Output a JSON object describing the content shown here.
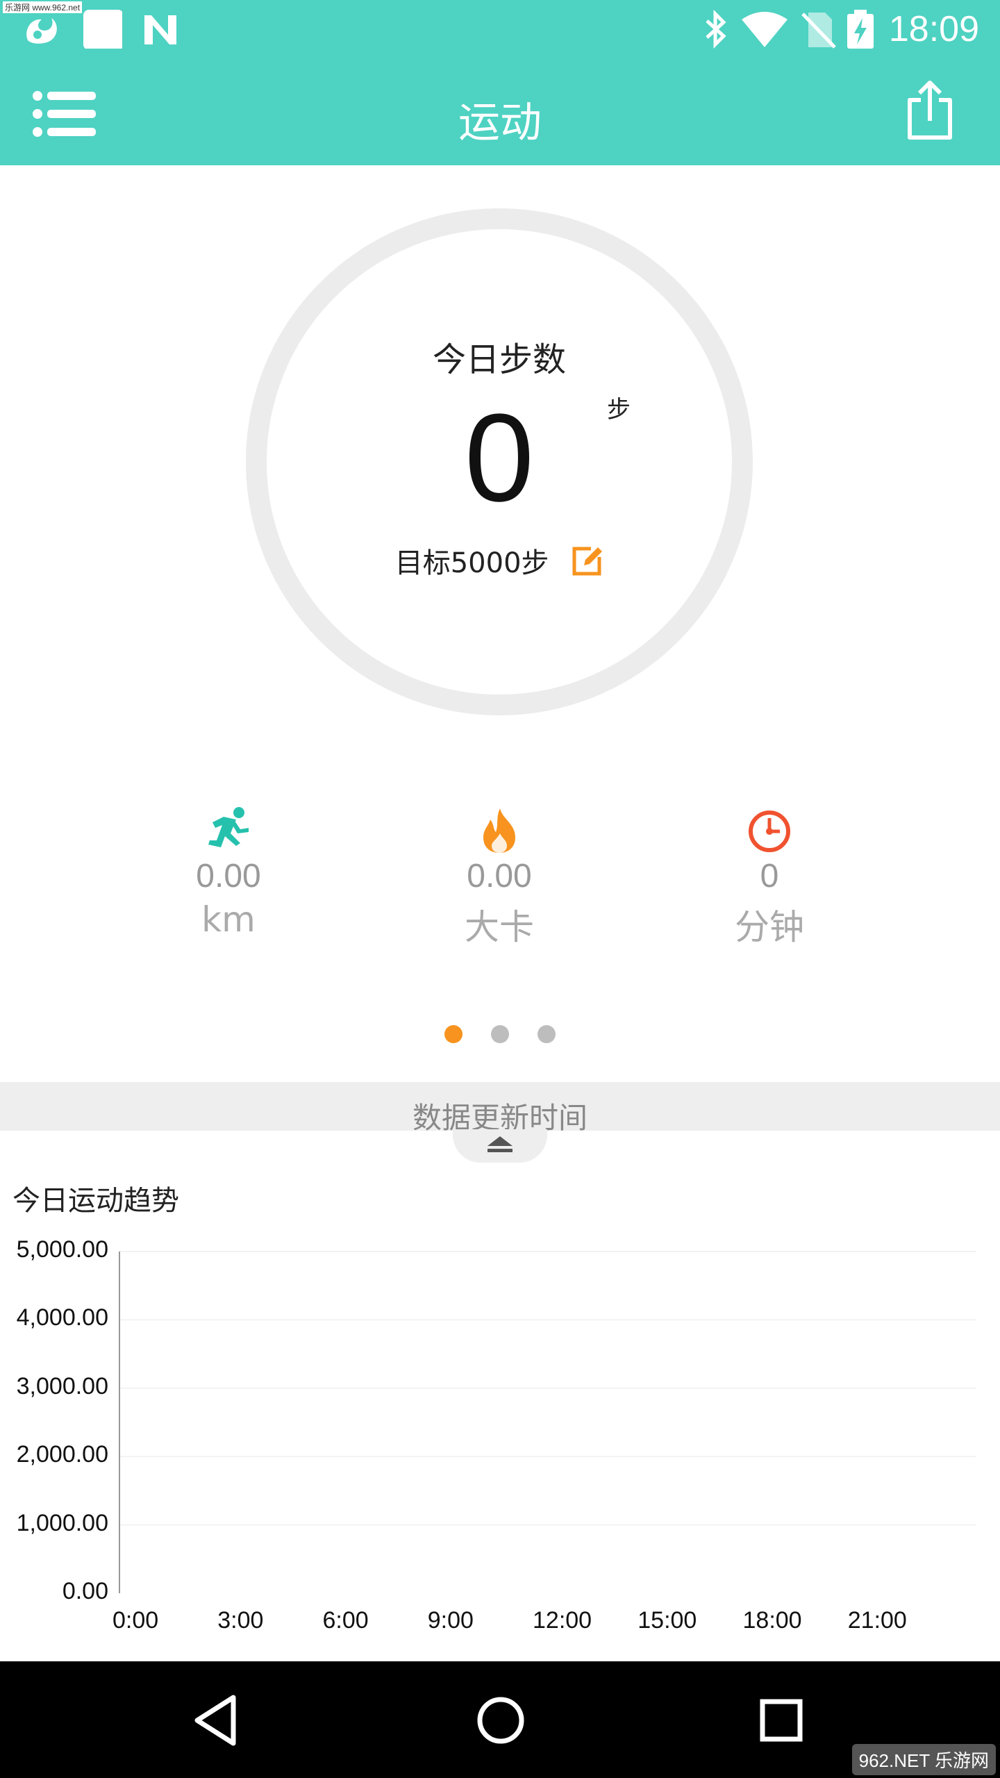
{
  "status_bar": {
    "time": "18:09",
    "watermark": "乐游网 www.962.net",
    "left_icons": [
      "uc-browser-icon",
      "square-notification-icon",
      "n-notification-icon"
    ],
    "right_icons": [
      "bluetooth-icon",
      "wifi-icon",
      "no-sim-icon",
      "battery-charging-icon"
    ]
  },
  "app_bar": {
    "title": "运动",
    "menu_icon": "list-menu-icon",
    "share_icon": "share-icon"
  },
  "steps_ring": {
    "label": "今日步数",
    "value": "0",
    "unit": "步",
    "goal_text": "目标5000步",
    "goal_progress": 0,
    "edit_icon": "edit-icon",
    "colors": {
      "ring": "#ececec",
      "edit": "#f7931e"
    }
  },
  "stats": [
    {
      "icon": "running-icon",
      "value": "0.00",
      "unit": "km",
      "color": "#25c1ad"
    },
    {
      "icon": "flame-icon",
      "value": "0.00",
      "unit": "大卡",
      "color": "#f7931e"
    },
    {
      "icon": "clock-icon",
      "value": "0",
      "unit": "分钟",
      "color": "#f0522f"
    }
  ],
  "pager": {
    "count": 3,
    "active": 0
  },
  "update_bar": {
    "text": "数据更新时间"
  },
  "chart_title": "今日运动趋势",
  "chart_data": {
    "type": "line",
    "title": "今日运动趋势",
    "xlabel": "",
    "ylabel": "",
    "x_ticks": [
      "0:00",
      "3:00",
      "6:00",
      "9:00",
      "12:00",
      "15:00",
      "18:00",
      "21:00"
    ],
    "y_ticks": [
      "0.00",
      "1,000.00",
      "2,000.00",
      "3,000.00",
      "4,000.00",
      "5,000.00"
    ],
    "ylim": [
      0,
      5000
    ],
    "xlim": [
      0,
      24
    ],
    "series": [],
    "grid": true
  },
  "nav_bar": {
    "buttons": [
      "back-icon",
      "home-icon",
      "recents-icon"
    ],
    "watermark": "962.NET 乐游网"
  },
  "colors": {
    "accent": "#4ed2c2",
    "orange": "#f7931e"
  }
}
